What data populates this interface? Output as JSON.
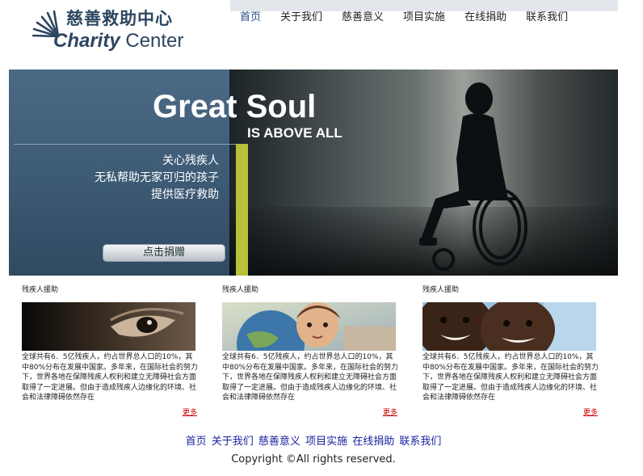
{
  "logo": {
    "name_cn": "慈善救助中心",
    "name_en_1": "Charity",
    "name_en_2": "Center"
  },
  "nav": [
    {
      "label": "首页",
      "active": true
    },
    {
      "label": "关于我们"
    },
    {
      "label": "慈善意义"
    },
    {
      "label": "项目实施"
    },
    {
      "label": "在线捐助"
    },
    {
      "label": "联系我们"
    }
  ],
  "banner": {
    "headline": "Great Soul",
    "subheadline": "IS ABOVE ALL",
    "slogan_lines": [
      "关心残疾人",
      "无私帮助无家可归的孩子",
      "提供医疗救助"
    ],
    "donate_label": "点击捐赠"
  },
  "columns": [
    {
      "title": "残疾人援助",
      "text": "全球共有6．5亿残疾人，约占世界总人口的10%，其中80%分布在发展中国家。多年来，在国际社会的努力下，世界各地在保障残疾人权利和建立无障碍社会方面取得了一定进展。但由于造成残疾人边缘化的环境、社会和法律障碍依然存在",
      "more": "更多"
    },
    {
      "title": "残疾人援助",
      "text": "全球共有6．5亿残疾人，约占世界总人口的10%，其中80%分布在发展中国家。多年来，在国际社会的努力下，世界各地在保障残疾人权利和建立无障碍社会方面取得了一定进展。但由于造成残疾人边缘化的环境、社会和法律障碍依然存在",
      "more": "更多"
    },
    {
      "title": "残疾人援助",
      "text": "全球共有6．5亿残疾人，约占世界总人口的10%，其中80%分布在发展中国家。多年来，在国际社会的努力下，世界各地在保障残疾人权利和建立无障碍社会方面取得了一定进展。但由于造成残疾人边缘化的环境、社会和法律障碍依然存在",
      "more": "更多"
    }
  ],
  "footer": {
    "links": [
      "首页",
      "关于我们",
      "慈善意义",
      "项目实施",
      "在线捐助",
      "联系我们"
    ],
    "copyright": "Copyright ©All rights reserved."
  },
  "colors": {
    "brand": "#2d4660",
    "nav_active": "#244a8c",
    "footer_link": "#1b22a0",
    "more_link": "#cc0000",
    "accent_green": "#b8c13a"
  }
}
